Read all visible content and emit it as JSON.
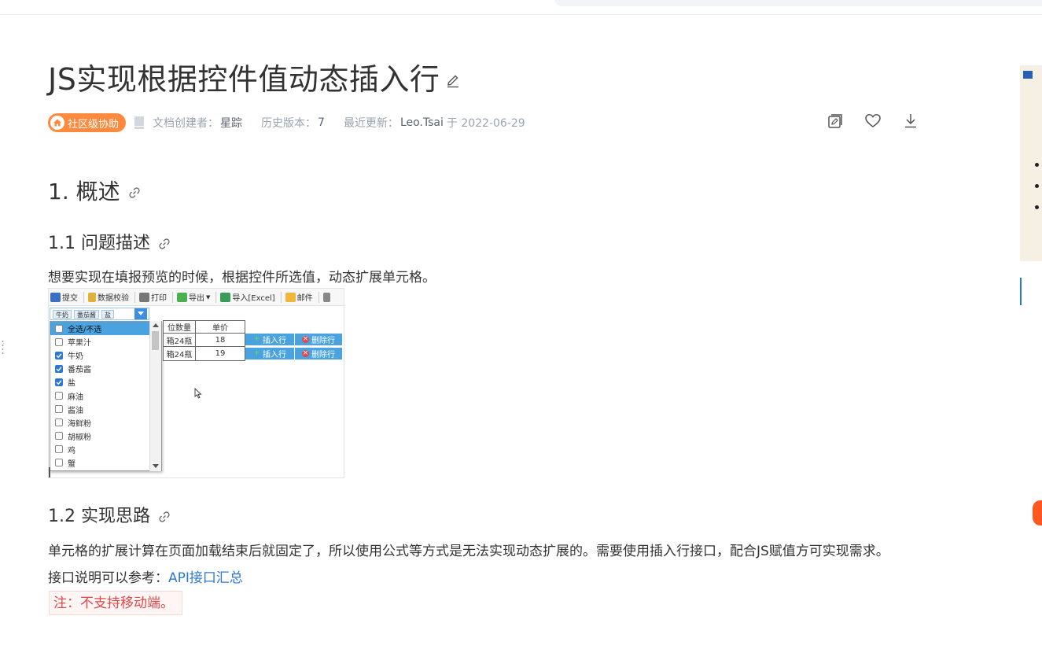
{
  "page": {
    "title": "JS实现根据控件值动态插入行",
    "badge": "社区级协助",
    "creator_label": "文档创建者：",
    "creator_name": "星踪",
    "history_label": "历史版本：",
    "history_count": "7",
    "updated_label": "最近更新：",
    "updated_by": "Leo.Tsai",
    "updated_on": "于 2022-06-29"
  },
  "sections": {
    "s1_title": "1. 概述",
    "s11_title": "1.1 问题描述",
    "s11_text": "想要实现在填报预览的时候，根据控件所选值，动态扩展单元格。",
    "s12_title": "1.2 实现思路",
    "s12_text": "单元格的扩展计算在页面加载结束后就固定了，所以使用公式等方式是无法实现动态扩展的。需要使用插入行接口，配合JS赋值方可实现需求。",
    "s12_ref_prefix": "接口说明可以参考：",
    "s12_ref_link": "API接口汇总",
    "note": "注：不支持移动端。"
  },
  "screenshot": {
    "toolbar": [
      "提交",
      "数据校验",
      "打印",
      "导出",
      "导入[Excel]",
      "邮件"
    ],
    "selected_tags": [
      "牛奶",
      "番茄酱",
      "盐"
    ],
    "dropdown_items": [
      {
        "label": "全选/不选",
        "checked": false
      },
      {
        "label": "苹果汁",
        "checked": false
      },
      {
        "label": "牛奶",
        "checked": true
      },
      {
        "label": "番茄酱",
        "checked": true
      },
      {
        "label": "盐",
        "checked": true
      },
      {
        "label": "麻油",
        "checked": false
      },
      {
        "label": "酱油",
        "checked": false
      },
      {
        "label": "海鲜粉",
        "checked": false
      },
      {
        "label": "胡椒粉",
        "checked": false
      },
      {
        "label": "鸡",
        "checked": false
      },
      {
        "label": "蟹",
        "checked": false
      }
    ],
    "grid_headers": [
      "位数量",
      "单价"
    ],
    "grid_rows": [
      {
        "qty": "箱24瓶",
        "price": "18"
      },
      {
        "qty": "箱24瓶",
        "price": "19"
      }
    ],
    "insert_label": "插入行",
    "delete_label": "删除行"
  },
  "colors": {
    "badge": "#ff8a3d",
    "link": "#2b78d4",
    "note_text": "#e04848",
    "note_bg": "#fff5f5"
  }
}
